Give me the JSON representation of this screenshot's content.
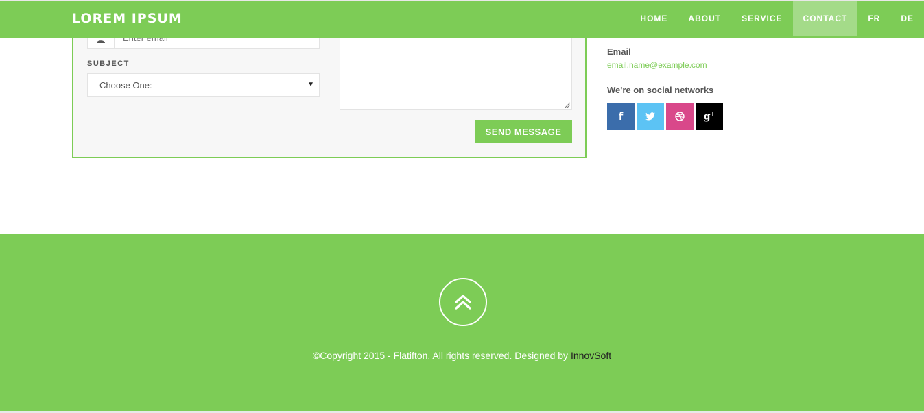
{
  "navbar": {
    "brand": "LOREM IPSUM",
    "items": [
      {
        "label": "HOME"
      },
      {
        "label": "ABOUT"
      },
      {
        "label": "SERVICE"
      },
      {
        "label": "CONTACT"
      },
      {
        "label": "FR"
      },
      {
        "label": "DE"
      }
    ],
    "active_item": "CONTACT"
  },
  "form": {
    "email_placeholder": "Enter email",
    "subject_label": "SUBJECT",
    "subject_selected": "Choose One:",
    "send_label": "SEND MESSAGE"
  },
  "contact_info": {
    "email_label": "Email",
    "email_value": "email.name@example.com",
    "social_label": "We're on social networks",
    "social_icons": [
      "facebook-icon",
      "twitter-icon",
      "dribbble-icon",
      "google-plus-icon"
    ]
  },
  "footer": {
    "copyright_text": "©Copyright 2015 - Flatifton. All rights reserved. Designed by ",
    "designer": "InnovSoft"
  },
  "colors": {
    "accent": "#7dcc56",
    "facebook": "#3b6dab",
    "twitter": "#5cc3f4",
    "dribbble": "#d9488a",
    "google_plus": "#000000"
  }
}
